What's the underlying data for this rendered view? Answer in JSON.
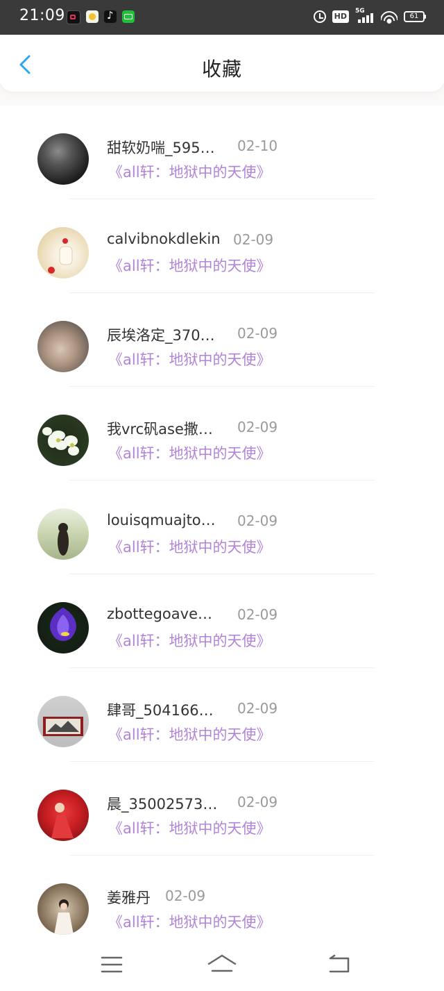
{
  "status_bar": {
    "time": "21:09",
    "network": "5G",
    "hd_label": "HD",
    "battery": "61",
    "app_icons": [
      "screen-recorder-icon",
      "smiley-app-icon",
      "tiktok-icon",
      "green-app-icon"
    ]
  },
  "header": {
    "title": "收藏",
    "back_icon": "chevron-left-icon",
    "accent_color": "#2aa6f4"
  },
  "list": {
    "link_color": "#b184d8",
    "items": [
      {
        "name": "甜软奶喘_595…",
        "date": "02-10",
        "book": "《all轩：地狱中的天使》"
      },
      {
        "name": "calvibnokdlekin",
        "date": "02-09",
        "book": "《all轩：地狱中的天使》"
      },
      {
        "name": "辰埃洛定_370…",
        "date": "02-09",
        "book": "《all轩：地狱中的天使》"
      },
      {
        "name": "我vrc矾ase撒…",
        "date": "02-09",
        "book": "《all轩：地狱中的天使》"
      },
      {
        "name": "louisqmuajto…",
        "date": "02-09",
        "book": "《all轩：地狱中的天使》"
      },
      {
        "name": "zbottegoave…",
        "date": "02-09",
        "book": "《all轩：地狱中的天使》"
      },
      {
        "name": "肆哥_504166…",
        "date": "02-09",
        "book": "《all轩：地狱中的天使》"
      },
      {
        "name": "晨_35002573…",
        "date": "02-09",
        "book": "《all轩：地狱中的天使》"
      },
      {
        "name": "姜雅丹",
        "date": "02-09",
        "book": "《all轩：地狱中的天使》"
      }
    ]
  },
  "nav_bar": {
    "buttons": [
      "menu-icon",
      "home-icon",
      "back-icon"
    ]
  }
}
